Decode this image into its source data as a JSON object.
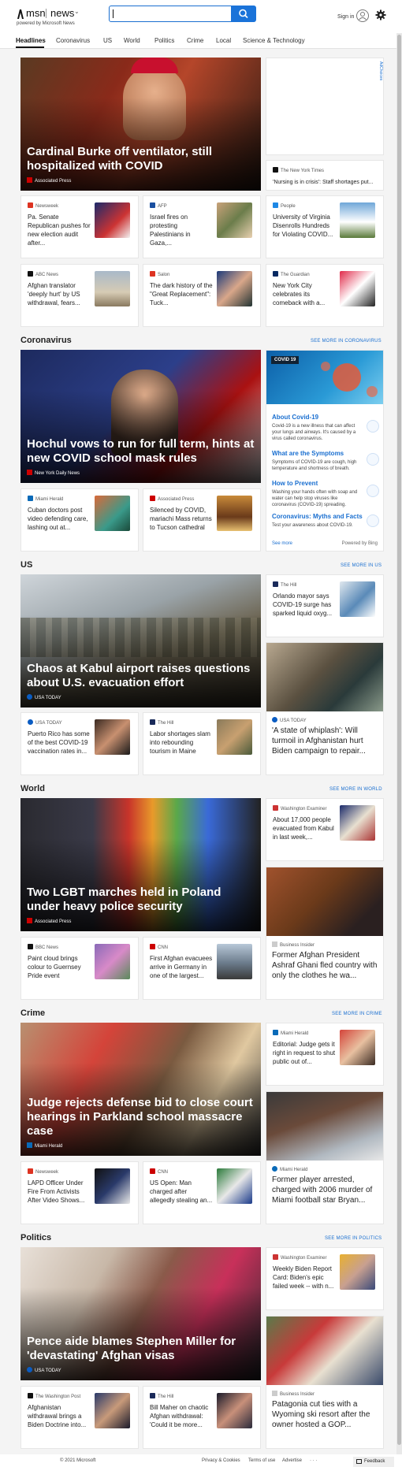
{
  "header": {
    "brand": "msn",
    "product": "news",
    "powered_by": "powered by Microsoft News",
    "search": {
      "value": "",
      "placeholder": ""
    },
    "sign_in": "Sign in"
  },
  "nav": {
    "items": [
      "Headlines",
      "Coronavirus",
      "US",
      "World",
      "Politics",
      "Crime",
      "Local",
      "Science & Technology"
    ],
    "active": "Headlines"
  },
  "ad": {
    "label": "AdChoices"
  },
  "top": {
    "hero": {
      "title": "Cardinal Burke off ventilator, still hospitalized with COVID",
      "source": "Associated Press"
    },
    "side": {
      "source": "The New York Times",
      "title": "'Nursing is in crisis': Staff shortages put..."
    },
    "cards": [
      {
        "source": "Newsweek",
        "title": "Pa. Senate Republican pushes for new election audit after..."
      },
      {
        "source": "AFP",
        "title": "Israel fires on protesting Palestinians in Gaza,..."
      },
      {
        "source": "People",
        "title": "University of Virginia Disenrolls Hundreds for Violating COVID..."
      },
      {
        "source": "ABC News",
        "title": "Afghan translator 'deeply hurt' by US withdrawal, fears..."
      },
      {
        "source": "Salon",
        "title": "The dark history of the \"Great Replacement\": Tuck..."
      },
      {
        "source": "The Guardian",
        "title": "New York City celebrates its comeback with a..."
      }
    ]
  },
  "coronavirus": {
    "title": "Coronavirus",
    "see_more": "SEE MORE IN CORONAVIRUS",
    "hero": {
      "title": "Hochul vows to run for full term, hints at new COVID school mask rules",
      "source": "New York Daily News"
    },
    "cards": [
      {
        "source": "Miami Herald",
        "title": "Cuban doctors post video defending care, lashing out at..."
      },
      {
        "source": "Associated Press",
        "title": "Silenced by COVID, mariachi Mass returns to Tucson cathedral"
      }
    ],
    "info": {
      "tag": "COVID 19",
      "items": [
        {
          "heading": "About Covid-19",
          "desc": "Covid-19 is a new illness that can affect your lungs and airways. It's caused by a virus called coronavirus."
        },
        {
          "heading": "What are the Symptoms",
          "desc": "Symptoms of COVID-19 are cough, high temperature and shortness of breath."
        },
        {
          "heading": "How to Prevent",
          "desc": "Washing your hands often with soap and water can help stop viruses like coronavirus (COVID-19) spreading."
        },
        {
          "heading": "Coronavirus: Myths and Facts",
          "desc": "Test your awareness about COVID-19."
        }
      ],
      "see_more": "See more",
      "powered": "Powered by Bing"
    }
  },
  "us": {
    "title": "US",
    "see_more": "SEE MORE IN US",
    "hero": {
      "title": "Chaos at Kabul airport raises questions about U.S. evacuation effort",
      "source": "USA TODAY"
    },
    "side": {
      "source": "The Hill",
      "title": "Orlando mayor says COVID-19 surge has sparked liquid oxyg..."
    },
    "tall": {
      "source": "USA TODAY",
      "title": "'A state of whiplash': Will turmoil in Afghanistan hurt Biden campaign to repair..."
    },
    "cards": [
      {
        "source": "USA TODAY",
        "title": "Puerto Rico has some of the best COVID-19 vaccination rates in..."
      },
      {
        "source": "The Hill",
        "title": "Labor shortages slam into rebounding tourism in Maine"
      }
    ]
  },
  "world": {
    "title": "World",
    "see_more": "SEE MORE IN WORLD",
    "hero": {
      "title": "Two LGBT marches held in Poland under heavy police security",
      "source": "Associated Press"
    },
    "side": {
      "source": "Washington Examiner",
      "title": "About 17,000 people evacuated from Kabul in last week,..."
    },
    "tall": {
      "source": "Business Insider",
      "title": "Former Afghan President Ashraf Ghani fled country with only the clothes he wa..."
    },
    "cards": [
      {
        "source": "BBC News",
        "title": "Paint cloud brings colour to Guernsey Pride event"
      },
      {
        "source": "CNN",
        "title": "First Afghan evacuees arrive in Germany in one of the largest..."
      }
    ]
  },
  "crime": {
    "title": "Crime",
    "see_more": "SEE MORE IN CRIME",
    "hero": {
      "title": "Judge rejects defense bid to close court hearings in Parkland school massacre case",
      "source": "Miami Herald"
    },
    "side": {
      "source": "Miami Herald",
      "title": "Editorial: Judge gets it right in request to shut public out of..."
    },
    "tall": {
      "source": "Miami Herald",
      "title": "Former player arrested, charged with 2006 murder of Miami football star Bryan..."
    },
    "cards": [
      {
        "source": "Newsweek",
        "title": "LAPD Officer Under Fire From Activists After Video Shows..."
      },
      {
        "source": "CNN",
        "title": "US Open: Man charged after allegedly stealing an..."
      }
    ]
  },
  "politics": {
    "title": "Politics",
    "see_more": "SEE MORE IN POLITICS",
    "hero": {
      "title": "Pence aide blames Stephen Miller for 'devastating' Afghan visas",
      "source": "USA TODAY"
    },
    "side": {
      "source": "Washington Examiner",
      "title": "Weekly Biden Report Card: Biden's epic failed week -- with n..."
    },
    "tall": {
      "source": "Business Insider",
      "title": "Patagonia cut ties with a Wyoming ski resort after the owner hosted a GOP..."
    },
    "cards": [
      {
        "source": "The Washington Post",
        "title": "Afghanistan withdrawal brings a Biden Doctrine into..."
      },
      {
        "source": "The Hill",
        "title": "Bill Maher on chaotic Afghan withdrawal: 'Could it be more..."
      }
    ]
  },
  "footer": {
    "copyright": "© 2021 Microsoft",
    "links": [
      "Privacy & Cookies",
      "Terms of use",
      "Advertise"
    ],
    "more": "· · ·",
    "feedback": "Feedback"
  }
}
